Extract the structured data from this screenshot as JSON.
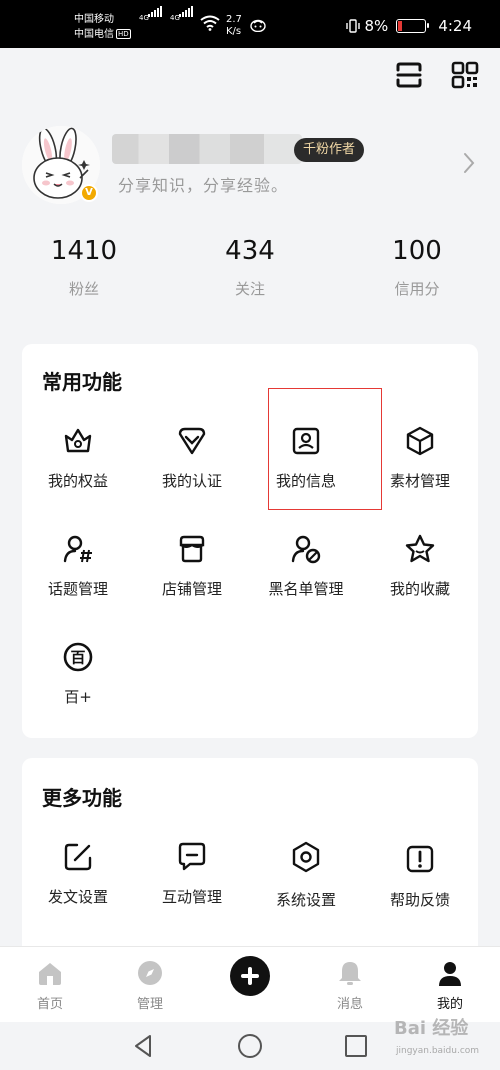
{
  "status_bar": {
    "carrier_1": "中国移动",
    "carrier_2": "中国电信",
    "carrier_2_badge": "HD",
    "network_1": "4G",
    "network_2": "4G",
    "speed_value": "2.7",
    "speed_unit": "K/s",
    "battery": "8%",
    "time": "4:24"
  },
  "profile": {
    "badge": "千粉作者",
    "bio": "分享知识，分享经验。",
    "verified_mark": "V"
  },
  "stats": [
    {
      "value": "1410",
      "label": "粉丝"
    },
    {
      "value": "434",
      "label": "关注"
    },
    {
      "value": "100",
      "label": "信用分"
    }
  ],
  "common": {
    "title": "常用功能",
    "items": [
      {
        "label": "我的权益",
        "icon": "crown-icon"
      },
      {
        "label": "我的认证",
        "icon": "heart-badge-icon"
      },
      {
        "label": "我的信息",
        "icon": "id-card-icon"
      },
      {
        "label": "素材管理",
        "icon": "cube-icon"
      },
      {
        "label": "话题管理",
        "icon": "user-hashtag-icon"
      },
      {
        "label": "店铺管理",
        "icon": "store-icon"
      },
      {
        "label": "黑名单管理",
        "icon": "user-block-icon"
      },
      {
        "label": "我的收藏",
        "icon": "star-icon"
      },
      {
        "label": "百+",
        "icon": "bai-circle-icon",
        "glyph": "百"
      }
    ]
  },
  "more": {
    "title": "更多功能",
    "items": [
      {
        "label": "发文设置",
        "icon": "edit-icon"
      },
      {
        "label": "互动管理",
        "icon": "chat-icon"
      },
      {
        "label": "系统设置",
        "icon": "settings-hex-icon"
      },
      {
        "label": "帮助反馈",
        "icon": "help-icon"
      }
    ]
  },
  "tabbar": {
    "home": "首页",
    "manage": "管理",
    "messages": "消息",
    "mine": "我的"
  },
  "watermark": {
    "main": "Bai 经验",
    "sub": "jingyan.baidu.com"
  },
  "colors": {
    "highlight": "#e53935",
    "badge_bg": "#2b2b2b",
    "badge_text": "#f1d8a6",
    "verified": "#f2a900"
  }
}
